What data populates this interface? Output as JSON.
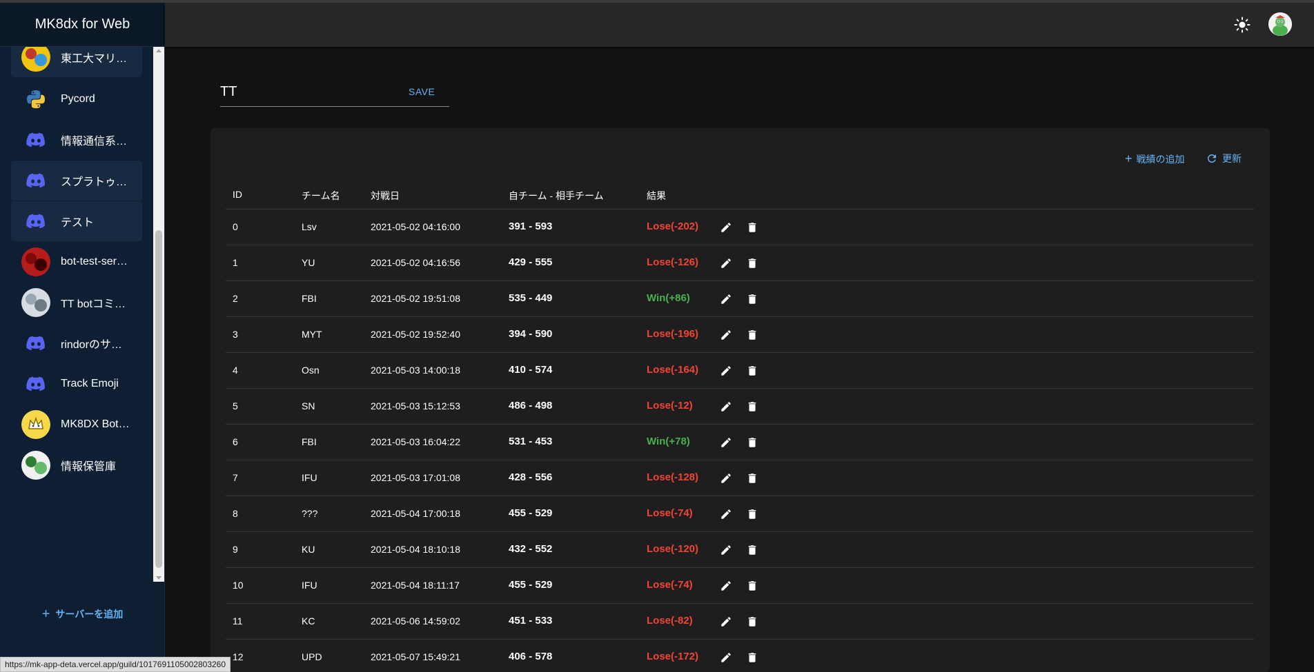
{
  "app": {
    "title": "MK8dx for Web"
  },
  "sidebar": {
    "servers": [
      {
        "label": "東工大マリ…",
        "icon": "server-avatar-icon",
        "active": true
      },
      {
        "label": "Pycord",
        "icon": "python-icon",
        "active": false
      },
      {
        "label": "情報通信系…",
        "icon": "discord-icon",
        "active": false
      },
      {
        "label": "スプラトゥ…",
        "icon": "discord-icon",
        "active": true
      },
      {
        "label": "テスト",
        "icon": "discord-icon",
        "active": true
      },
      {
        "label": "bot-test-ser…",
        "icon": "server-avatar-icon",
        "active": false
      },
      {
        "label": "TT botコミ…",
        "icon": "server-avatar-icon",
        "active": false
      },
      {
        "label": "rindorのサ…",
        "icon": "discord-icon",
        "active": false
      },
      {
        "label": "Track Emoji",
        "icon": "discord-icon",
        "active": false
      },
      {
        "label": "MK8DX Bot…",
        "icon": "crown-icon",
        "active": false
      },
      {
        "label": "情報保管庫",
        "icon": "server-avatar-icon",
        "active": false
      }
    ],
    "add_server_label": "サーバーを追加"
  },
  "name_field": {
    "value": "TT",
    "save_label": "SAVE"
  },
  "toolbar": {
    "add_record_label": "戦績の追加",
    "refresh_label": "更新"
  },
  "table": {
    "headers": {
      "id": "ID",
      "team": "チーム名",
      "date": "対戦日",
      "score": "自チーム - 相手チーム",
      "result": "結果"
    },
    "rows": [
      {
        "id": "0",
        "team": "Lsv",
        "date": "2021-05-02 04:16:00",
        "score": "391 - 593",
        "result": "Lose(-202)",
        "win": false
      },
      {
        "id": "1",
        "team": "YU",
        "date": "2021-05-02 04:16:56",
        "score": "429 - 555",
        "result": "Lose(-126)",
        "win": false
      },
      {
        "id": "2",
        "team": "FBI",
        "date": "2021-05-02 19:51:08",
        "score": "535 - 449",
        "result": "Win(+86)",
        "win": true
      },
      {
        "id": "3",
        "team": "MYT",
        "date": "2021-05-02 19:52:40",
        "score": "394 - 590",
        "result": "Lose(-196)",
        "win": false
      },
      {
        "id": "4",
        "team": "Osn",
        "date": "2021-05-03 14:00:18",
        "score": "410 - 574",
        "result": "Lose(-164)",
        "win": false
      },
      {
        "id": "5",
        "team": "SN",
        "date": "2021-05-03 15:12:53",
        "score": "486 - 498",
        "result": "Lose(-12)",
        "win": false
      },
      {
        "id": "6",
        "team": "FBI",
        "date": "2021-05-03 16:04:22",
        "score": "531 - 453",
        "result": "Win(+78)",
        "win": true
      },
      {
        "id": "7",
        "team": "IFU",
        "date": "2021-05-03 17:01:08",
        "score": "428 - 556",
        "result": "Lose(-128)",
        "win": false
      },
      {
        "id": "8",
        "team": "???",
        "date": "2021-05-04 17:00:18",
        "score": "455 - 529",
        "result": "Lose(-74)",
        "win": false
      },
      {
        "id": "9",
        "team": "KU",
        "date": "2021-05-04 18:10:18",
        "score": "432 - 552",
        "result": "Lose(-120)",
        "win": false
      },
      {
        "id": "10",
        "team": "IFU",
        "date": "2021-05-04 18:11:17",
        "score": "455 - 529",
        "result": "Lose(-74)",
        "win": false
      },
      {
        "id": "11",
        "team": "KC",
        "date": "2021-05-06 14:59:02",
        "score": "451 - 533",
        "result": "Lose(-82)",
        "win": false
      },
      {
        "id": "12",
        "team": "UPD",
        "date": "2021-05-07 15:49:21",
        "score": "406 - 578",
        "result": "Lose(-172)",
        "win": false
      }
    ]
  },
  "colors": {
    "win": "#4caf50",
    "lose": "#f44336",
    "accent": "#64b5f6",
    "discord": "#5865f2"
  },
  "status_bar": {
    "url": "https://mk-app-deta.vercel.app/guild/1017691105002803260"
  }
}
